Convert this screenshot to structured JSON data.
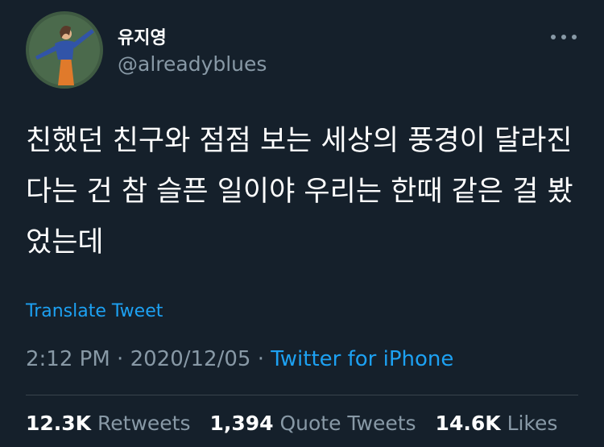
{
  "author": {
    "display_name": "유지영",
    "handle": "@alreadyblues",
    "avatar_icon": "person-avatar-icon"
  },
  "more_icon": "ellipsis-icon",
  "tweet": {
    "text": "친했던 친구와 점점 보는 세상의 풍경이 달라진다는 건 참 슬픈 일이야 우리는 한때 같은 걸 봤었는데",
    "translate_label": "Translate Tweet",
    "time": "2:12 PM",
    "separator": "·",
    "date": "2020/12/05",
    "source": "Twitter for iPhone"
  },
  "stats": {
    "retweets_count": "12.3K",
    "retweets_label": "Retweets",
    "quotes_count": "1,394",
    "quotes_label": "Quote Tweets",
    "likes_count": "14.6K",
    "likes_label": "Likes"
  },
  "colors": {
    "background": "#15202b",
    "accent": "#1da1f2",
    "muted": "#8899a6",
    "divider": "#38444d"
  }
}
